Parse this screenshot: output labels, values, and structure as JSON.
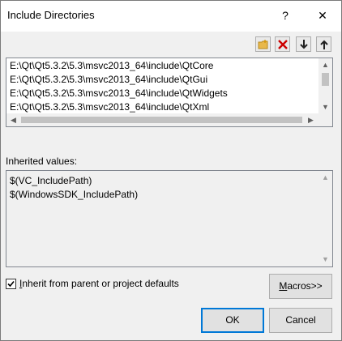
{
  "dialog": {
    "title": "Include Directories",
    "help_glyph": "?",
    "close_glyph": "✕"
  },
  "toolbar": {
    "icons": [
      "new-folder-icon",
      "delete-icon",
      "move-down-icon",
      "move-up-icon"
    ],
    "delete_color": "#cc0000"
  },
  "list": {
    "items": [
      "E:\\Qt\\Qt5.3.2\\5.3\\msvc2013_64\\include\\QtCore",
      "E:\\Qt\\Qt5.3.2\\5.3\\msvc2013_64\\include\\QtGui",
      "E:\\Qt\\Qt5.3.2\\5.3\\msvc2013_64\\include\\QtWidgets",
      "E:\\Qt\\Qt5.3.2\\5.3\\msvc2013_64\\include\\QtXml"
    ]
  },
  "inherited": {
    "label": "Inherited values:",
    "items": [
      "$(VC_IncludePath)",
      "$(WindowsSDK_IncludePath)"
    ]
  },
  "inherit_checkbox": {
    "label_mnemonic": "I",
    "label_rest": "nherit from parent or project defaults",
    "checked": true
  },
  "buttons": {
    "macros_mnemonic": "M",
    "macros_rest": "acros>>",
    "ok": "OK",
    "cancel": "Cancel"
  },
  "colors": {
    "accent": "#0078d7",
    "folder": "#e8b84a"
  }
}
